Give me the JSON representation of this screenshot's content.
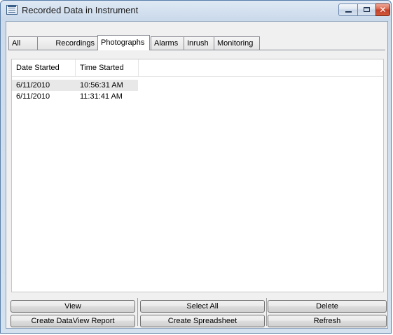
{
  "window": {
    "title": "Recorded Data in Instrument",
    "icon": "window-list-icon",
    "controls": {
      "minimize": "minimize-icon",
      "maximize": "maximize-icon",
      "close": "close-icon",
      "close_glyph": "✕"
    }
  },
  "tabs": [
    {
      "label": "All"
    },
    {
      "label": "Recordings"
    },
    {
      "label": "Photographs"
    },
    {
      "label": "Alarms"
    },
    {
      "label": "Inrush"
    },
    {
      "label": "Monitoring"
    }
  ],
  "active_tab": "Photographs",
  "list": {
    "columns": [
      "Date Started",
      "Time Started"
    ],
    "rows": [
      {
        "date": "6/11/2010",
        "time": "10:56:31 AM"
      },
      {
        "date": "6/11/2010",
        "time": "11:31:41 AM"
      }
    ]
  },
  "buttons": {
    "view": "View",
    "select_all": "Select All",
    "delete": "Delete",
    "create_report": "Create DataView Report",
    "create_spreadsheet": "Create Spreadsheet",
    "refresh": "Refresh"
  }
}
